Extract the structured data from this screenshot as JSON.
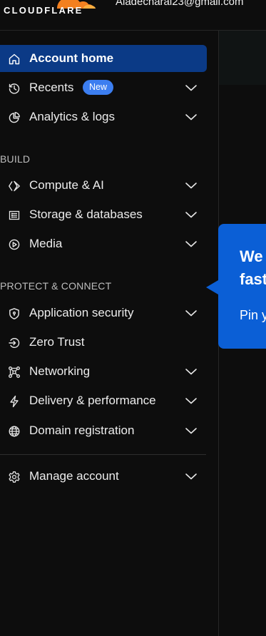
{
  "header": {
    "logo_text": "CLOUDFLARE",
    "user_email": "Aladecharai23@gmail.com"
  },
  "sidebar": {
    "active_color": "#0b3a86",
    "items_top": [
      {
        "label": "Account home",
        "icon": "home-icon",
        "active": true,
        "chevron": false
      },
      {
        "label": "Recents",
        "icon": "history-icon",
        "badge": "New",
        "chevron": true
      },
      {
        "label": "Analytics & logs",
        "icon": "pie-chart-icon",
        "chevron": true
      }
    ],
    "section_build": "BUILD",
    "items_build": [
      {
        "label": "Compute & AI",
        "icon": "compute-icon",
        "chevron": true
      },
      {
        "label": "Storage & databases",
        "icon": "storage-icon",
        "chevron": true
      },
      {
        "label": "Media",
        "icon": "play-icon",
        "chevron": true
      }
    ],
    "section_protect": "PROTECT & CONNECT",
    "items_protect": [
      {
        "label": "Application security",
        "icon": "shield-icon",
        "chevron": true
      },
      {
        "label": "Zero Trust",
        "icon": "zero-trust-icon",
        "chevron": false
      },
      {
        "label": "Networking",
        "icon": "network-icon",
        "chevron": true
      },
      {
        "label": "Delivery & performance",
        "icon": "lightning-icon",
        "chevron": true
      },
      {
        "label": "Domain registration",
        "icon": "globe-icon",
        "chevron": true
      }
    ],
    "items_bottom": [
      {
        "label": "Manage account",
        "icon": "gear-icon",
        "chevron": true
      }
    ]
  },
  "tooltip": {
    "title": "We",
    "title_line2": "fast",
    "body": "Pin y",
    "color": "#0b5fd6"
  }
}
